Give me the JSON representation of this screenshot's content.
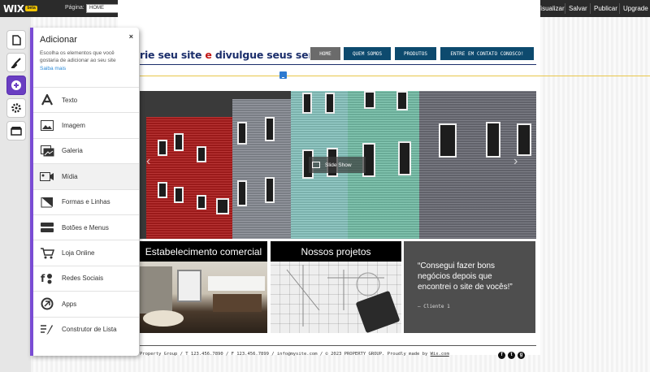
{
  "toolbar": {
    "logo": "WIX",
    "beta_badge": "beta",
    "page_label": "Página:",
    "page_value": "HOME",
    "preview": "Pré-Visualizar",
    "save": "Salvar",
    "publish": "Publicar",
    "upgrade": "Upgrade"
  },
  "leftbar": {
    "items": [
      "pages-icon",
      "design-icon",
      "add-icon",
      "settings-icon",
      "market-icon"
    ],
    "active": "add-icon"
  },
  "panel": {
    "title": "Adicionar",
    "close": "×",
    "description": "Escolha os elementos que você gostaria de adicionar ao seu site",
    "learn_more": "Saiba mais",
    "items": [
      {
        "label": "Texto",
        "icon": "text-icon"
      },
      {
        "label": "Imagem",
        "icon": "image-icon"
      },
      {
        "label": "Galeria",
        "icon": "gallery-icon"
      },
      {
        "label": "Mídia",
        "icon": "media-icon"
      },
      {
        "label": "Formas e Linhas",
        "icon": "shapes-icon"
      },
      {
        "label": "Botões e Menus",
        "icon": "buttons-menus-icon"
      },
      {
        "label": "Loja Online",
        "icon": "cart-icon"
      },
      {
        "label": "Redes Sociais",
        "icon": "social-icon"
      },
      {
        "label": "Apps",
        "icon": "apps-icon"
      },
      {
        "label": "Construtor de Lista",
        "icon": "list-builder-icon"
      }
    ]
  },
  "site": {
    "headline_part1": "rie seu site ",
    "headline_part2": "e",
    "headline_part3": " divulgue seus serviços",
    "nav": [
      "HOME",
      "QUEM SOMOS",
      "PRODUTOS",
      "ENTRE EM CONTATO CONOSCO!"
    ],
    "slideshow_label": "Slide Show",
    "tile1_title": "Estabelecimento comercial",
    "tile2_title": "Nossos projetos",
    "quote": "“Consegui fazer bons negócios depois que encontrei o site de vocês!”",
    "quote_author": "– Cliente 1",
    "footer_text": "Property Group / T 123.456.7890 / F 123.456.7899 / info@mysite.com / © 2023 PROPERTY GROUP. Proudly made by ",
    "footer_link": "Wix.com",
    "social": [
      "f",
      "t",
      "g"
    ]
  },
  "colors": {
    "accent": "#7a4cd4",
    "nav_active": "#6b6b6b",
    "nav": "#0d4a6e",
    "headline": "#1b2e6b",
    "headline_accent": "#c11616"
  }
}
